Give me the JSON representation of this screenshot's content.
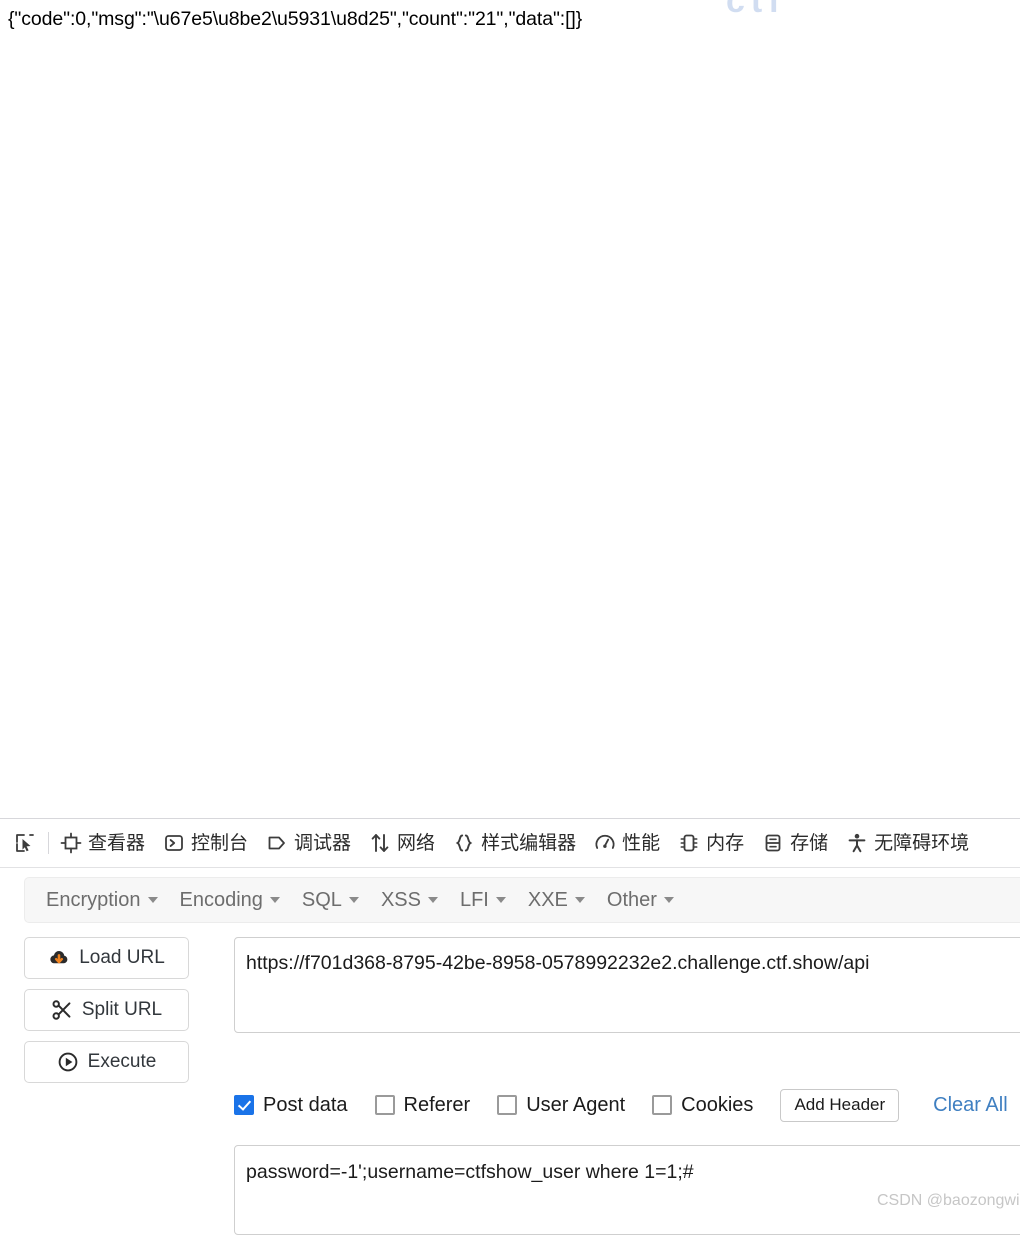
{
  "page": {
    "response_body": "{\"code\":0,\"msg\":\"\\u67e5\\u8be2\\u5931\\u8d25\",\"count\":\"21\",\"data\":[]}",
    "background_watermark": "ctf"
  },
  "devtools": {
    "picker_icon": "element-picker-icon",
    "tabs": [
      {
        "label": "查看器",
        "icon": "inspector-icon"
      },
      {
        "label": "控制台",
        "icon": "console-icon"
      },
      {
        "label": "调试器",
        "icon": "debugger-icon"
      },
      {
        "label": "网络",
        "icon": "network-icon"
      },
      {
        "label": "样式编辑器",
        "icon": "style-editor-icon"
      },
      {
        "label": "性能",
        "icon": "performance-icon"
      },
      {
        "label": "内存",
        "icon": "memory-icon"
      },
      {
        "label": "存储",
        "icon": "storage-icon"
      },
      {
        "label": "无障碍环境",
        "icon": "accessibility-icon"
      }
    ]
  },
  "hackbar": {
    "menu": [
      {
        "label": "Encryption"
      },
      {
        "label": "Encoding"
      },
      {
        "label": "SQL"
      },
      {
        "label": "XSS"
      },
      {
        "label": "LFI"
      },
      {
        "label": "XXE"
      },
      {
        "label": "Other"
      }
    ],
    "buttons": [
      {
        "label": "Load URL",
        "icon": "cloud-download-icon"
      },
      {
        "label": "Split URL",
        "icon": "scissors-icon"
      },
      {
        "label": "Execute",
        "icon": "play-circle-icon"
      }
    ],
    "url_value": "https://f701d368-8795-42be-8958-0578992232e2.challenge.ctf.show/api",
    "url_placeholder": "",
    "options": [
      {
        "label": "Post data",
        "checked": true
      },
      {
        "label": "Referer",
        "checked": false
      },
      {
        "label": "User Agent",
        "checked": false
      },
      {
        "label": "Cookies",
        "checked": false
      }
    ],
    "add_header_label": "Add Header",
    "clear_all_label": "Clear All",
    "post_data_value": "password=-1';username=ctfshow_user where 1=1;#",
    "post_data_placeholder": ""
  },
  "watermark": {
    "text": "CSDN @baozongwi"
  },
  "colors": {
    "accent_blue": "#1a73e8",
    "link_blue": "#3f7fc1",
    "icon_orange": "#f0821e",
    "toolbar_bg": "#ffffff",
    "menu_bg": "#f7f7f7"
  }
}
